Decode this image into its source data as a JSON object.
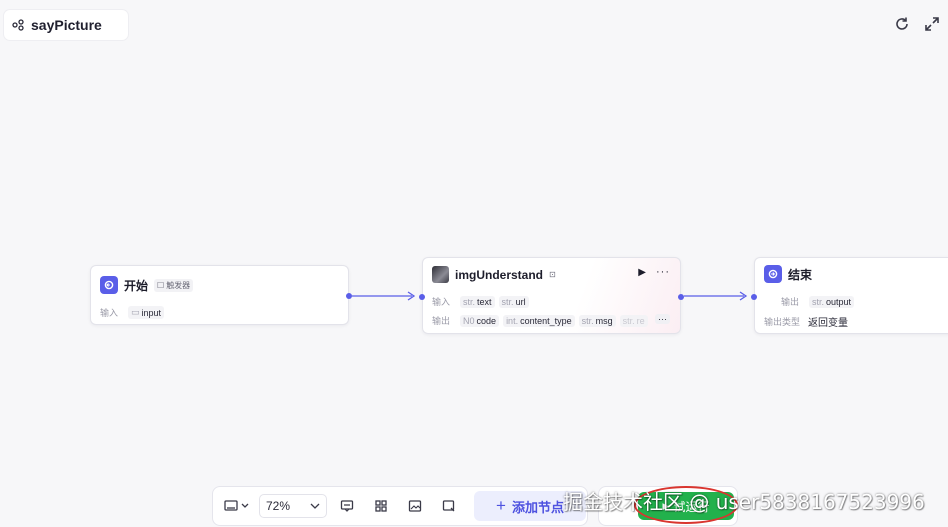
{
  "app": {
    "title": "sayPicture"
  },
  "top_actions": [
    {
      "icon": "refresh-icon"
    },
    {
      "icon": "fullscreen-icon"
    }
  ],
  "nodes": {
    "start": {
      "title": "开始",
      "tag": "触发器",
      "input_label": "输入",
      "inputs": [
        {
          "type_icon": "image-icon",
          "name": "input"
        }
      ]
    },
    "img": {
      "title": "imgUnderstand",
      "input_label": "输入",
      "inputs": [
        {
          "type": "str.",
          "name": "text"
        },
        {
          "type": "str.",
          "name": "url"
        }
      ],
      "output_label": "输出",
      "outputs": [
        {
          "type": "N0",
          "name": "code"
        },
        {
          "type": "int.",
          "name": "content_type"
        },
        {
          "type": "str.",
          "name": "msg"
        },
        {
          "type": "str.",
          "name": "re"
        }
      ],
      "more": "···"
    },
    "end": {
      "title": "结束",
      "output_label": "输出",
      "outputs": [
        {
          "type": "str.",
          "name": "output"
        }
      ],
      "output_type_label": "输出类型",
      "output_type_value": "返回变量"
    }
  },
  "toolbar": {
    "zoom": "72%",
    "add_node": "添加节点",
    "run": "试运行"
  },
  "watermark": "掘金技术社区 @ user5838167523996",
  "colors": {
    "accent": "#5a5ee8",
    "run": "#22b14c",
    "highlight": "#d9352f"
  }
}
